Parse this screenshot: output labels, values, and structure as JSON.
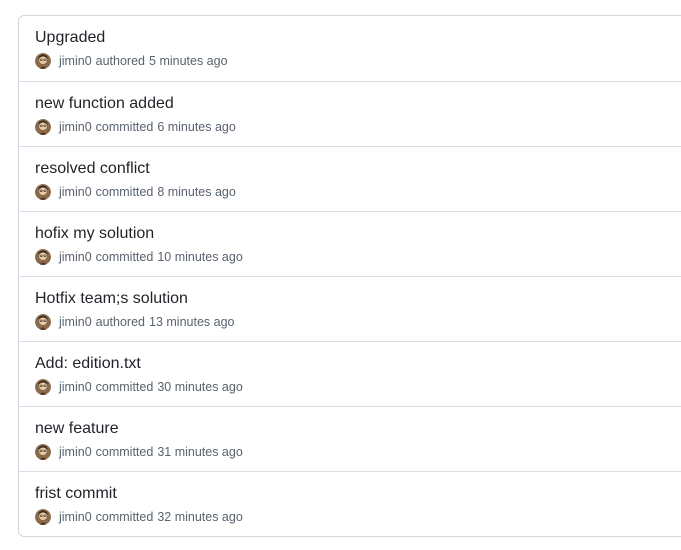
{
  "commits": [
    {
      "title": "Upgraded",
      "author": "jimin0",
      "action": "authored",
      "time": "5 minutes ago"
    },
    {
      "title": "new function added",
      "author": "jimin0",
      "action": "committed",
      "time": "6 minutes ago"
    },
    {
      "title": "resolved conflict",
      "author": "jimin0",
      "action": "committed",
      "time": "8 minutes ago"
    },
    {
      "title": "hofix my solution",
      "author": "jimin0",
      "action": "committed",
      "time": "10 minutes ago"
    },
    {
      "title": "Hotfix team;s solution",
      "author": "jimin0",
      "action": "authored",
      "time": "13 minutes ago"
    },
    {
      "title": "Add: edition.txt",
      "author": "jimin0",
      "action": "committed",
      "time": "30 minutes ago"
    },
    {
      "title": "new feature",
      "author": "jimin0",
      "action": "committed",
      "time": "31 minutes ago"
    },
    {
      "title": "frist commit",
      "author": "jimin0",
      "action": "committed",
      "time": "32 minutes ago"
    }
  ],
  "icons": {
    "avatar": "user-avatar-icon"
  },
  "colors": {
    "border": "#d0d7de",
    "meta_text": "#59636e",
    "title_text": "#1f2328"
  }
}
